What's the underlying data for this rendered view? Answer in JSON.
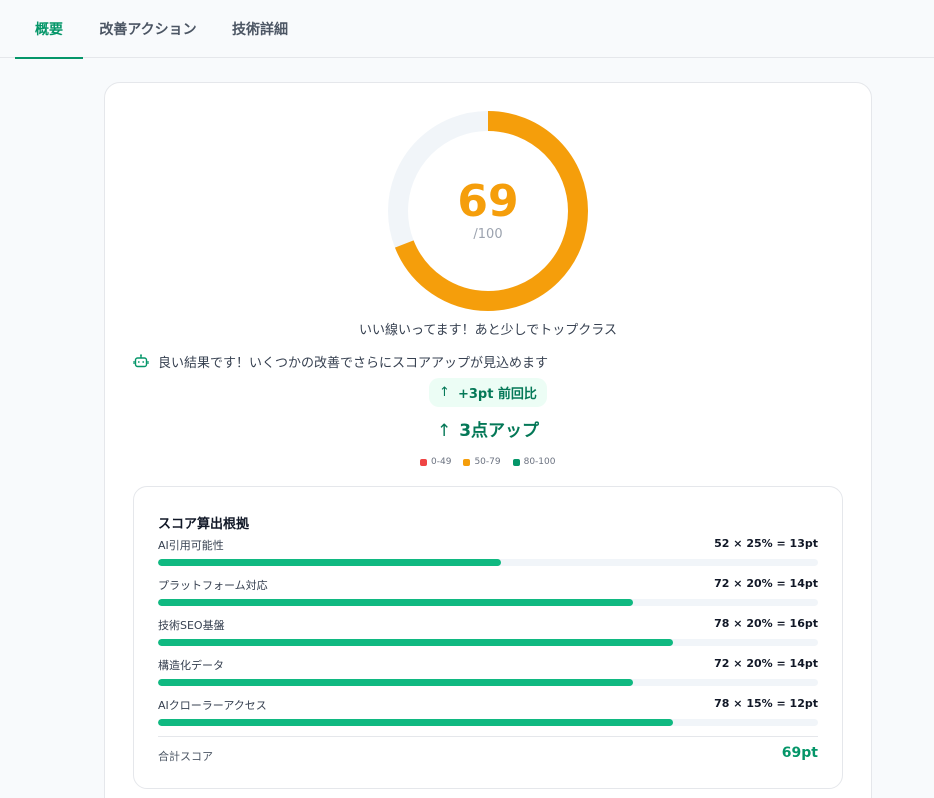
{
  "tabs": [
    {
      "label": "概要",
      "active": true
    },
    {
      "label": "改善アクション",
      "active": false
    },
    {
      "label": "技術詳細",
      "active": false
    }
  ],
  "score": {
    "value": 69,
    "display": "69",
    "max_label": "/100",
    "color": "#f59e0b",
    "track_color": "#f1f5f9"
  },
  "tagline": "いい線いってます！あと少しでトップクラス",
  "ai_comment": {
    "icon": "robot-icon",
    "text": "良い結果です！いくつかの改善でさらにスコアアップが見込めます"
  },
  "delta": {
    "arrow": "↑",
    "badge_text": "+3pt 前回比",
    "big_text": "3点アップ"
  },
  "legend": [
    {
      "label": "0-49",
      "color": "#ef4444"
    },
    {
      "label": "50-79",
      "color": "#f59e0b"
    },
    {
      "label": "80-100",
      "color": "#059669"
    }
  ],
  "basis": {
    "title": "スコア算出根拠",
    "rows": [
      {
        "label": "AI引用可能性",
        "calc": "52 × 25% = 13pt",
        "score": 52
      },
      {
        "label": "プラットフォーム対応",
        "calc": "72 × 20% = 14pt",
        "score": 72
      },
      {
        "label": "技術SEO基盤",
        "calc": "78 × 20% = 16pt",
        "score": 78
      },
      {
        "label": "構造化データ",
        "calc": "72 × 20% = 14pt",
        "score": 72
      },
      {
        "label": "AIクローラーアクセス",
        "calc": "78 × 15% = 12pt",
        "score": 78
      }
    ],
    "total_label": "合計スコア",
    "total_value": "69pt",
    "bar_color": "#10b981"
  }
}
